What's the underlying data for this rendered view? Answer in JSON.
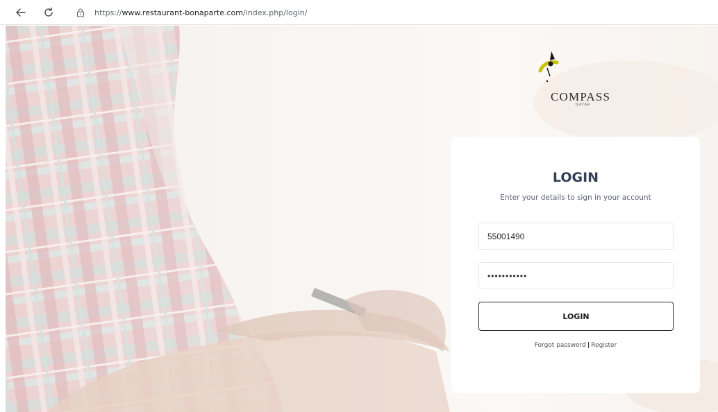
{
  "browser": {
    "url_prefix": "https://",
    "url_host": "www.restaurant-bonaparte.com",
    "url_path": "/index.php/login/"
  },
  "logo": {
    "text": "COMPASS",
    "sub": "QATAR"
  },
  "login": {
    "title": "LOGIN",
    "subtitle": "Enter your details to sign in your account",
    "username_value": "55001490",
    "password_value": "•••••••••••",
    "button_label": "LOGIN",
    "forgot_label": "Forgot password",
    "separator": "|",
    "register_label": "Register"
  },
  "colors": {
    "title": "#353f55",
    "logo_yellow": "#c8c20a",
    "card": "#ffffff"
  }
}
